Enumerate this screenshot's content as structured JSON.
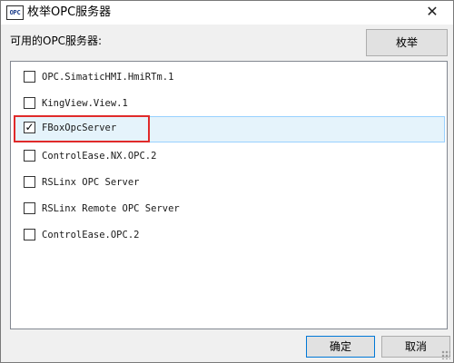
{
  "window": {
    "icon_text": "OPC",
    "title": "枚举OPC服务器",
    "close_symbol": "✕"
  },
  "main": {
    "list_label": "可用的OPC服务器:",
    "enum_button": "枚举"
  },
  "servers": [
    {
      "name": "OPC.SimaticHMI.HmiRTm.1",
      "checked": false
    },
    {
      "name": "KingView.View.1",
      "checked": false
    },
    {
      "name": "FBoxOpcServer",
      "checked": true
    },
    {
      "name": "ControlEase.NX.OPC.2",
      "checked": false
    },
    {
      "name": "RSLinx OPC Server",
      "checked": false
    },
    {
      "name": "RSLinx Remote OPC Server",
      "checked": false
    },
    {
      "name": "ControlEase.OPC.2",
      "checked": false
    }
  ],
  "footer": {
    "ok_label": "确定",
    "cancel_label": "取消"
  },
  "colors": {
    "highlight_border": "#e02a2a",
    "selected_row_bg": "#e5f3fb"
  }
}
